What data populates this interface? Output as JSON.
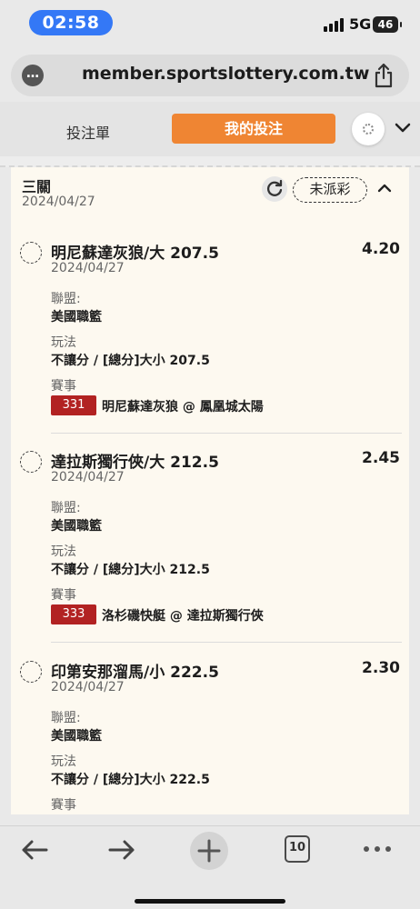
{
  "status_bar": {
    "time": "02:58",
    "network": "5G",
    "battery": "46"
  },
  "browser": {
    "url": "member.sportslottery.com.tw",
    "tab_count": "10"
  },
  "tabs": {
    "bet_slip": "投注單",
    "my_bets": "我的投注"
  },
  "bet_group": {
    "title": "三關",
    "date": "2024/04/27",
    "status": "未派彩"
  },
  "bets": [
    {
      "name": "明尼蘇達灰狼/大 207.5",
      "odds": "4.20",
      "date": "2024/04/27",
      "league_label": "聯盟:",
      "league": "美國職籃",
      "market_label": "玩法",
      "market": "不讓分 / [總分]大小 207.5",
      "event_label": "賽事",
      "game_number": "331",
      "matchup": "明尼蘇達灰狼 @ 鳳凰城太陽"
    },
    {
      "name": "達拉斯獨行俠/大 212.5",
      "odds": "2.45",
      "date": "2024/04/27",
      "league_label": "聯盟:",
      "league": "美國職籃",
      "market_label": "玩法",
      "market": "不讓分 / [總分]大小 212.5",
      "event_label": "賽事",
      "game_number": "333",
      "matchup": "洛杉磯快艇 @ 達拉斯獨行俠"
    },
    {
      "name": "印第安那溜馬/小 222.5",
      "odds": "2.30",
      "date": "2024/04/27",
      "league_label": "聯盟:",
      "league": "美國職籃",
      "market_label": "玩法",
      "market": "不讓分 / [總分]大小 222.5",
      "event_label": "賽事"
    }
  ],
  "colors": {
    "accent": "#ef8533",
    "game_badge": "#b22222",
    "time_pill": "#3478f6",
    "card_bg": "#fdf9f0"
  }
}
